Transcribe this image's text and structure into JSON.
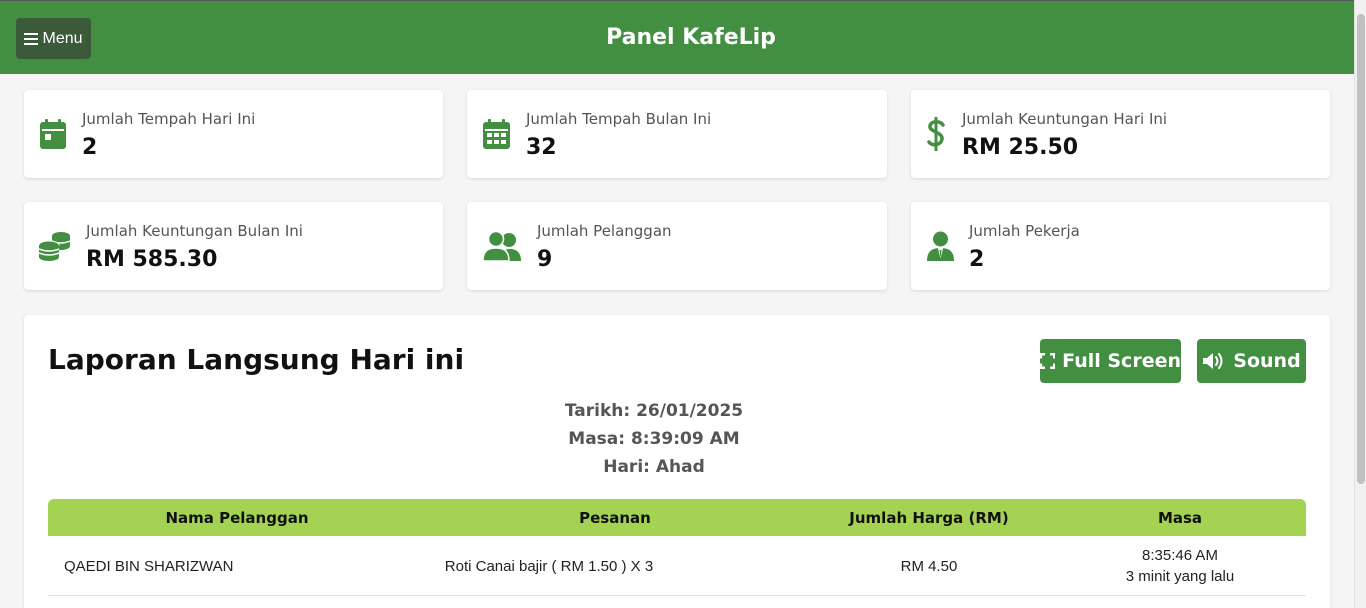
{
  "header": {
    "menu_label": "Menu",
    "title": "Panel KafeLip",
    "accent_color": "#438f42"
  },
  "stats": [
    {
      "label": "Jumlah Tempah Hari Ini",
      "value": "2",
      "icon": "calendar-icon"
    },
    {
      "label": "Jumlah Tempah Bulan Ini",
      "value": "32",
      "icon": "calendar-grid-icon"
    },
    {
      "label": "Jumlah Keuntungan Hari Ini",
      "value": "RM 25.50",
      "icon": "dollar-icon"
    },
    {
      "label": "Jumlah Keuntungan Bulan Ini",
      "value": "RM 585.30",
      "icon": "coins-icon"
    },
    {
      "label": "Jumlah Pelanggan",
      "value": "9",
      "icon": "users-icon"
    },
    {
      "label": "Jumlah Pekerja",
      "value": "2",
      "icon": "worker-icon"
    }
  ],
  "report": {
    "title": "Laporan Langsung Hari ini",
    "fullscreen_label": "Full Screen",
    "sound_label": "Sound",
    "date_line": "Tarikh: 26/01/2025",
    "time_line": "Masa: 8:39:09 AM",
    "day_line": "Hari: Ahad",
    "columns": [
      "Nama Pelanggan",
      "Pesanan",
      "Jumlah Harga (RM)",
      "Masa"
    ],
    "rows": [
      {
        "customer": "QAEDI BIN SHARIZWAN",
        "order": "Roti Canai bajir ( RM 1.50 ) X 3",
        "total": "RM 4.50",
        "time": "8:35:46 AM",
        "ago": "3 minit yang lalu"
      }
    ],
    "header_color": "#a4d253"
  }
}
